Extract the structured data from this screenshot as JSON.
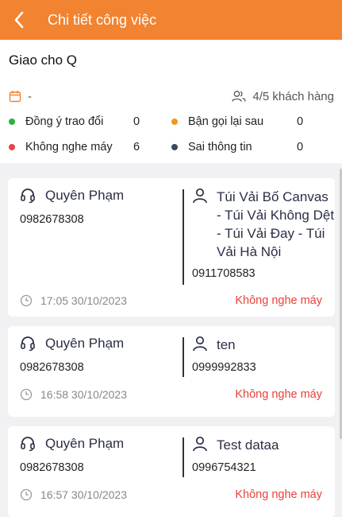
{
  "header": {
    "title": "Chi tiết công việc"
  },
  "summary": {
    "assign_title": "Giao cho Q",
    "date": "-",
    "customers": "4/5 khách hàng",
    "stats": [
      {
        "label": "Đồng ý trao đổi",
        "count": "0",
        "color": "#27b142"
      },
      {
        "label": "Bận gọi lại sau",
        "count": "0",
        "color": "#f0961c"
      },
      {
        "label": "Không nghe máy",
        "count": "6",
        "color": "#e84545"
      },
      {
        "label": "Sai thông tin",
        "count": "0",
        "color": "#3c4a5e"
      }
    ]
  },
  "calls": [
    {
      "agent": "Quyên Phạm",
      "agent_phone": "0982678308",
      "customer": "Túi Vải Bố Canvas - Túi Vải Không Dệt - Túi Vải Đay - Túi Vải Hà Nội",
      "customer_phone": "0911708583",
      "time": "17:05 30/10/2023",
      "status": "Không nghe máy"
    },
    {
      "agent": "Quyên Phạm",
      "agent_phone": "0982678308",
      "customer": "ten",
      "customer_phone": "0999992833",
      "time": "16:58 30/10/2023",
      "status": "Không nghe máy"
    },
    {
      "agent": "Quyên Phạm",
      "agent_phone": "0982678308",
      "customer": "Test dataa",
      "customer_phone": "0996754321",
      "time": "16:57 30/10/2023",
      "status": "Không nghe máy"
    }
  ]
}
